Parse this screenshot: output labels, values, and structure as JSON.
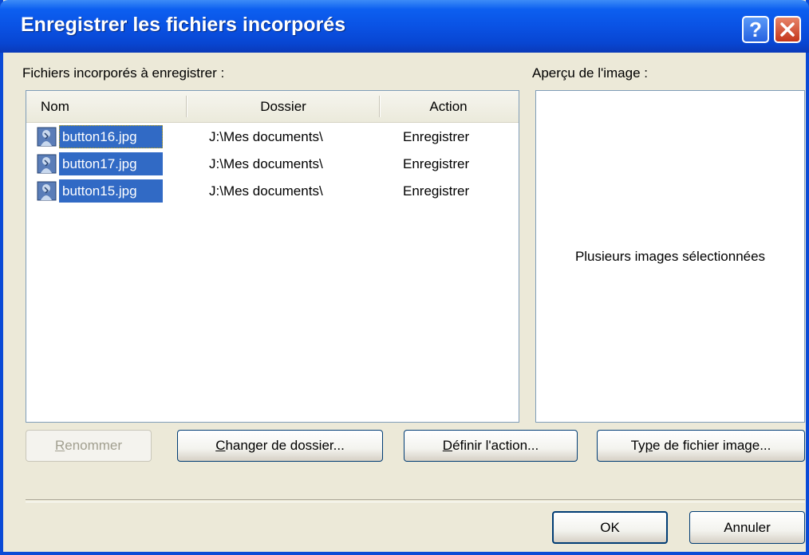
{
  "window": {
    "title": "Enregistrer les fichiers incorporés",
    "help_label": "?",
    "close_label": "Fermer"
  },
  "files_label": "Fichiers incorporés à enregistrer :",
  "preview_label": "Aperçu de l'image :",
  "columns": {
    "name": "Nom",
    "folder": "Dossier",
    "action": "Action"
  },
  "rows": [
    {
      "name": "button16.jpg",
      "folder": "J:\\Mes documents\\",
      "action": "Enregistrer",
      "selected": true,
      "focused": true
    },
    {
      "name": "button17.jpg",
      "folder": "J:\\Mes documents\\",
      "action": "Enregistrer",
      "selected": true,
      "focused": false
    },
    {
      "name": "button15.jpg",
      "folder": "J:\\Mes documents\\",
      "action": "Enregistrer",
      "selected": true,
      "focused": false
    }
  ],
  "preview_text": "Plusieurs images sélectionnées",
  "buttons": {
    "rename": {
      "accel": "R",
      "rest": "enommer",
      "enabled": false
    },
    "change_folder": {
      "accel": "C",
      "rest": "hanger de dossier..."
    },
    "set_action": {
      "accel": "D",
      "rest": "éfinir l'action..."
    },
    "image_type": {
      "pre": "Ty",
      "accel": "p",
      "rest": "e de fichier image..."
    },
    "ok": "OK",
    "cancel": "Annuler"
  },
  "colors": {
    "title_bar": "#0a52e4",
    "selection": "#316ac5",
    "dialog_bg": "#ece9d8"
  },
  "icons": {
    "file": "image-file-icon"
  }
}
